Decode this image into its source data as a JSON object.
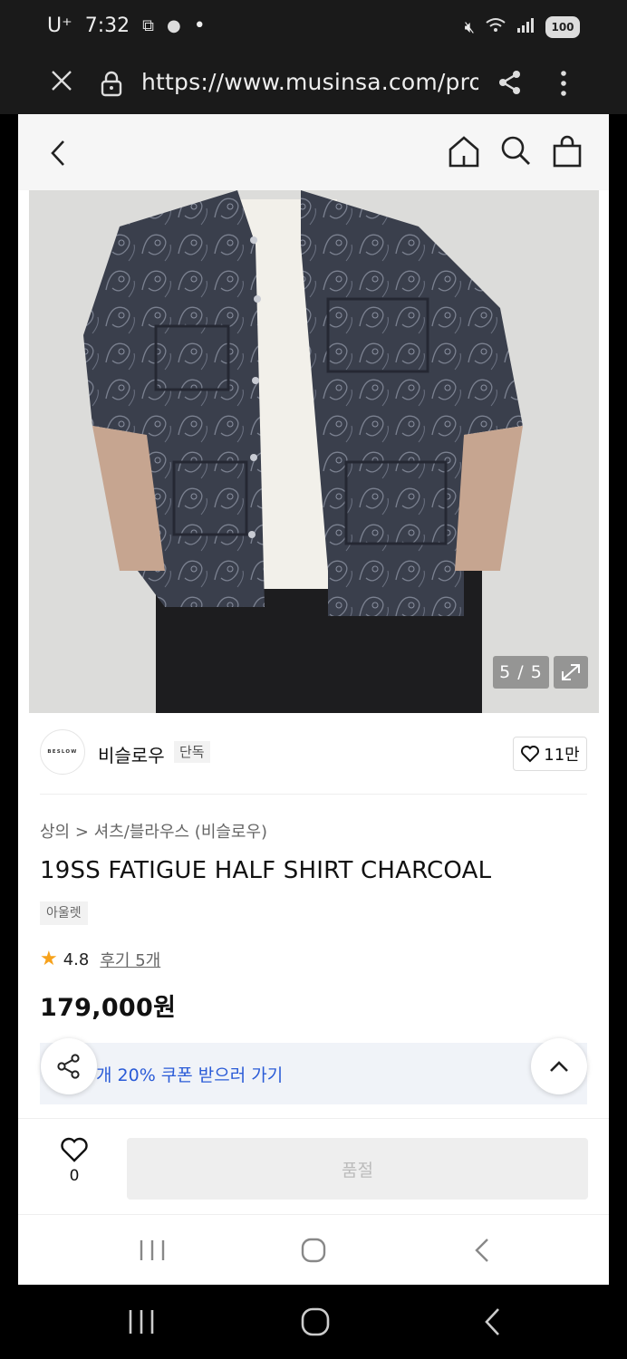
{
  "status_bar": {
    "carrier": "U⁺",
    "time": "7:32",
    "dot": "•",
    "battery_label": "100"
  },
  "browser": {
    "url": "https://www.musinsa.com/produ"
  },
  "product_image": {
    "counter": "5 / 5"
  },
  "brand": {
    "logo_text": "BESLOW",
    "name": "비슬로우",
    "badge": "단독",
    "likes": "11만"
  },
  "product": {
    "breadcrumb": "상의 > 셔츠/블라우스 (비슬로우)",
    "title": "19SS FATIGUE HALF SHIRT CHARCOAL",
    "tag": "아울렛",
    "rating": "4.8",
    "reviews": "후기 5개",
    "price": "179,000원"
  },
  "coupon": {
    "text": "개 20% 쿠폰 받으러 가기"
  },
  "purchase_bar": {
    "wish_count": "0",
    "soldout_label": "품절"
  },
  "colors": {
    "accent_blue": "#2a5bd7",
    "star": "#f7a21b",
    "coupon_bg": "#f0f3f8"
  }
}
